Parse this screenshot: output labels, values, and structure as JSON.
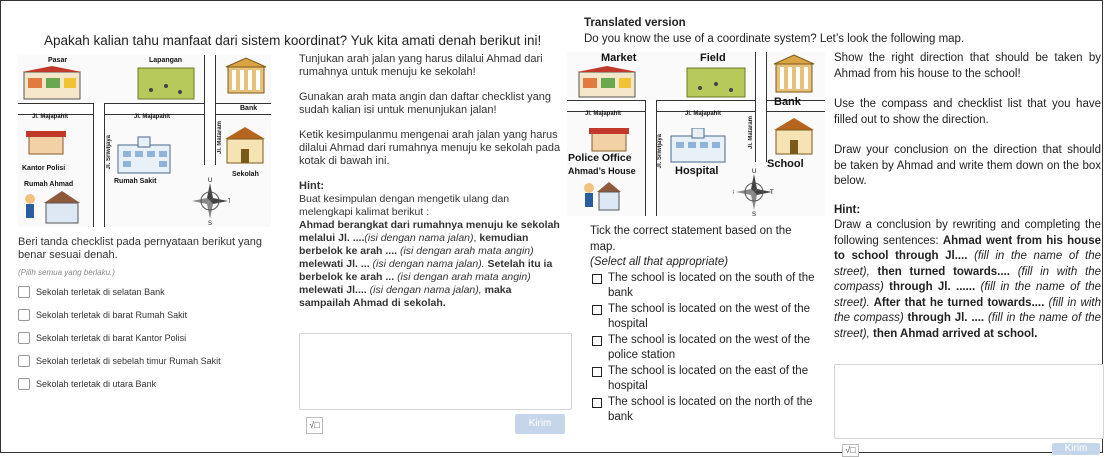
{
  "original": {
    "heading": "Apakah kalian tahu manfaat dari sistem koordinat? Yuk kita amati denah berikut ini!",
    "map": {
      "pasar": "Pasar",
      "lapangan": "Lapangan",
      "bank": "Bank",
      "jl_majapahit_1": "Jl. Majapahit",
      "jl_majapahit_2": "Jl. Majapahit",
      "jl_mataram": "Jl. Mataram",
      "jl_sriwijaya": "Jl. Sriwijaya",
      "kantor_polisi": "Kantor Polisi",
      "rumah_sakit": "Rumah Sakit",
      "sekolah": "Sekolah",
      "rumah_ahmad": "Rumah Ahmad",
      "compass": {
        "n": "U",
        "s": "S",
        "w": "B",
        "e": "T"
      }
    },
    "instr_1": "Tunjukan arah jalan yang harus dilalui Ahmad dari rumahnya untuk menuju ke sekolah!",
    "instr_2": "Gunakan arah mata angin dan daftar checklist yang sudah kalian isi untuk menunjukan jalan!",
    "instr_3": "Ketik kesimpulanmu mengenai arah jalan yang harus dilalui Ahmad dari rumahnya menuju ke sekolah pada kotak di bawah ini.",
    "hint_title": "Hint:",
    "hint_intro": "Buat kesimpulan dengan mengetik ulang dan melengkapi kalimat berikut :",
    "hint_s1": "Ahmad berangkat dari rumahnya menuju ke sekolah melalui Jl. ....",
    "hint_s1_i": "(isi dengan nama jalan)",
    "hint_s2": "kemudian berbelok ke arah ....",
    "hint_s2_i": "(isi dengan arah mata angin)",
    "hint_s3": "melewati Jl. ...",
    "hint_s3_i": "(isi dengan nama jalan).",
    "hint_s4": "Setelah itu ia berbelok ke arah ...",
    "hint_s4_i": "(isi dengan arah mata angin)",
    "hint_s5": "melewati Jl.... ",
    "hint_s5_i": "(isi dengan nama jalan),",
    "hint_s6": "maka sampailah Ahmad di sekolah.",
    "check_prompt": "Beri tanda checklist pada pernyataan berikut yang benar sesuai denah.",
    "check_note": "(Pilih semua yang berlaku.)",
    "options": [
      "Sekolah terletak di selatan Bank",
      "Sekolah terletak di  barat Rumah Sakit",
      "Sekolah terletak di  barat Kantor Polisi",
      "Sekolah terletak di sebelah timur Rumah Sakit",
      "Sekolah terletak di utara Bank"
    ],
    "sqrt": "√□",
    "send": "Kirim"
  },
  "translated": {
    "title": "Translated version",
    "heading": "Do you know the use of a coordinate system? Let’s look the following map.",
    "map": {
      "market": "Market",
      "field": "Field",
      "bank": "Bank",
      "jl_majapahit_1": "Jl. Majapahit",
      "jl_majapahit_2": "Jl. Majapahit",
      "jl_mataram": "Jl. Mataram",
      "jl_sriwijaya": "Jl. Sriwijaya",
      "police_office": "Police Office",
      "ahmads_house": "Ahmad’s House",
      "hospital": "Hospital",
      "school": "School",
      "compass": {
        "n": "U",
        "s": "S",
        "w": "B",
        "e": "T"
      }
    },
    "check_prompt": "Tick the correct statement based on the map.",
    "check_note": "(Select all that appropriate)",
    "options": [
      "The school is located on the south of the bank",
      "The school is located on the west of the hospital",
      "The school is located on the west of the police station",
      "The school is located on the east of the hospital",
      "The school is located on the north of the bank"
    ],
    "instr_1": "Show the right direction that should be taken by Ahmad from his house to the school!",
    "instr_2": "Use the compass and checklist list that you have filled out to show the direction.",
    "instr_3": "Draw your conclusion on the direction that should be taken by Ahmad and write them down on the box below.",
    "hint_title": "Hint:",
    "hint_intro": "Draw a conclusion by rewriting and completing the following sentences:",
    "hint_s1": "Ahmad went from his house to school through Jl.... ",
    "hint_s1_i": "(fill in the name of the street),",
    "hint_s2": " then turned towards.... ",
    "hint_s2_i": "(fill in with the compass)",
    "hint_s3": " through Jl. ...... ",
    "hint_s3_i": "(fill in the name of the street).",
    "hint_s4": " After that he turned towards.... ",
    "hint_s4_i": "(fill in with the compass)",
    "hint_s5": " through Jl. .... ",
    "hint_s5_i": "(fill in the name of the street),",
    "hint_s6": " then Ahmad arrived at school.",
    "sqrt": "√□",
    "send": "Kirim"
  }
}
